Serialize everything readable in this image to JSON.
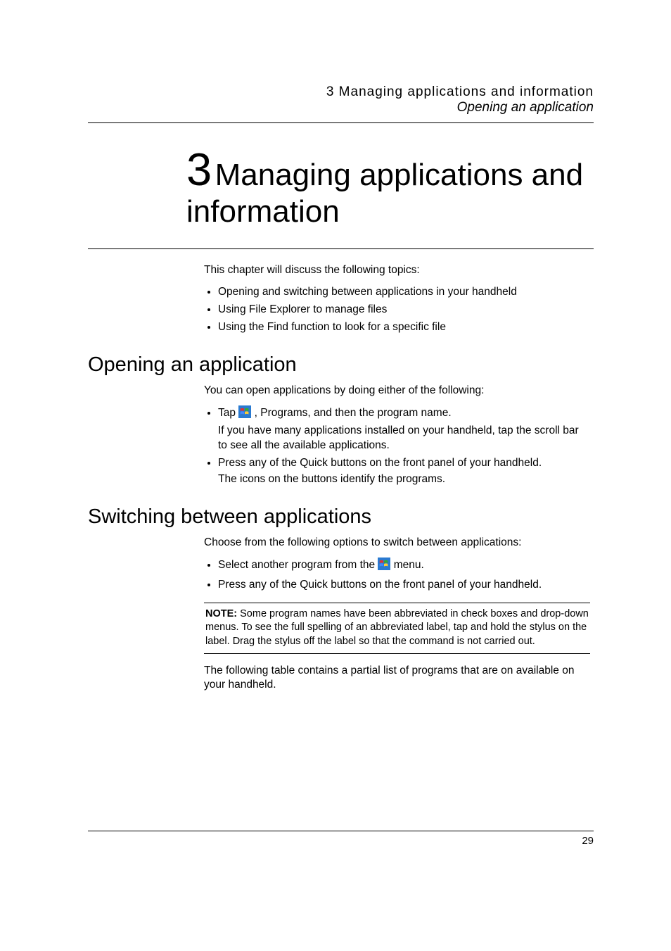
{
  "header": {
    "line1": "3 Managing applications and information",
    "line2": "Opening an application"
  },
  "chapter": {
    "number": "3",
    "title": "Managing applications and information"
  },
  "intro": {
    "lead": "This chapter will discuss the following topics:",
    "bullets": [
      "Opening and switching between applications in your handheld",
      "Using File Explorer to manage files",
      "Using the Find function to look for a specific file"
    ]
  },
  "section_open": {
    "heading": "Opening an application",
    "lead": "You can open applications by doing either of the following:",
    "item1_pre": "Tap ",
    "item1_post": ", Programs, and then the program name.",
    "item1_sub": "If you have many applications installed on your handheld, tap the scroll bar to see all the available applications.",
    "item2": "Press any of the Quick buttons on the front panel of your handheld.",
    "item2_sub": "The icons on the buttons identify the programs."
  },
  "section_switch": {
    "heading": "Switching between applications",
    "lead": "Choose from the following options to switch between applications:",
    "item1_pre": "Select another program from the ",
    "item1_post": " menu.",
    "item2": "Press any of the Quick buttons on the front panel of your handheld."
  },
  "note": {
    "label": "NOTE:",
    "text": "Some program names have been abbreviated in check boxes and drop-down menus. To see the full spelling of an abbreviated label, tap and hold the stylus on the label. Drag the stylus off the label so that the command is not carried out."
  },
  "closing": "The following table contains a partial list of programs that are on available on your handheld.",
  "page_number": "29"
}
